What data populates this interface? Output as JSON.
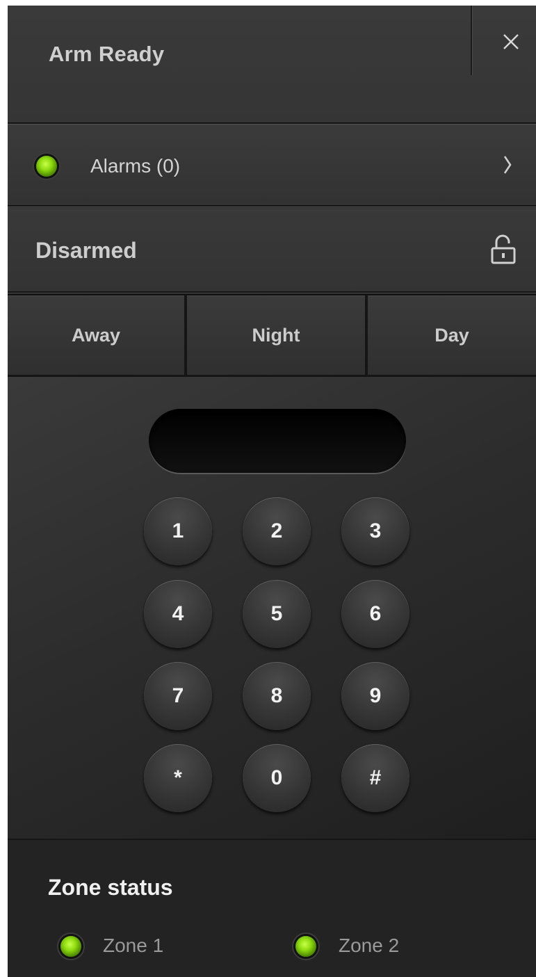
{
  "header": {
    "title": "Arm Ready",
    "close_icon": "close-icon"
  },
  "alarms": {
    "label": "Alarms (0)",
    "led_color": "#8fdc10",
    "chevron_icon": "chevron-right-icon"
  },
  "status": {
    "label": "Disarmed",
    "icon": "unlocked-padlock-icon"
  },
  "modes": [
    {
      "label": "Away"
    },
    {
      "label": "Night"
    },
    {
      "label": "Day"
    }
  ],
  "keypad": {
    "display_value": "",
    "keys": [
      "1",
      "2",
      "3",
      "4",
      "5",
      "6",
      "7",
      "8",
      "9",
      "*",
      "0",
      "#"
    ]
  },
  "zones": {
    "title": "Zone status",
    "items": [
      {
        "label": "Zone 1",
        "led_color": "#8fdc10"
      },
      {
        "label": "Zone 2",
        "led_color": "#8fdc10"
      }
    ]
  },
  "colors": {
    "panel_bg": "#2a2a2a",
    "led_green": "#8fdc10",
    "text_light": "#cfcfcf"
  }
}
